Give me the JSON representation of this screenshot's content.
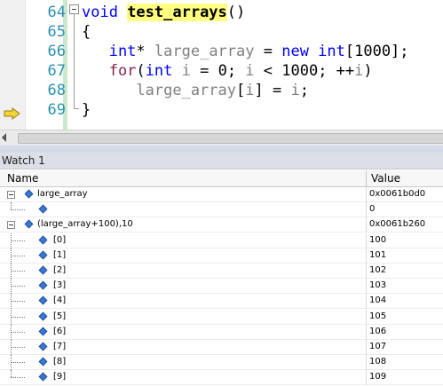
{
  "editor": {
    "lines": [
      {
        "num": "64",
        "parts": [
          {
            "t": "void ",
            "c": "kw"
          },
          {
            "t": "test_arrays",
            "c": "fnhl"
          },
          {
            "t": "()",
            "c": "plain"
          }
        ]
      },
      {
        "num": "65",
        "parts": [
          {
            "t": "{",
            "c": "plain"
          }
        ]
      },
      {
        "num": "66",
        "parts": [
          {
            "t": "   int",
            "c": "kw"
          },
          {
            "t": "* ",
            "c": "plain"
          },
          {
            "t": "large_array",
            "c": "ident"
          },
          {
            "t": " = ",
            "c": "plain"
          },
          {
            "t": "new int",
            "c": "kw"
          },
          {
            "t": "[1000];",
            "c": "plain"
          }
        ]
      },
      {
        "num": "67",
        "parts": [
          {
            "t": "   for",
            "c": "kw2"
          },
          {
            "t": "(",
            "c": "plain"
          },
          {
            "t": "int ",
            "c": "kw"
          },
          {
            "t": "i",
            "c": "ident"
          },
          {
            "t": " = 0; ",
            "c": "plain"
          },
          {
            "t": "i",
            "c": "ident"
          },
          {
            "t": " < 1000; ++",
            "c": "plain"
          },
          {
            "t": "i",
            "c": "ident"
          },
          {
            "t": ")",
            "c": "plain"
          }
        ]
      },
      {
        "num": "68",
        "parts": [
          {
            "t": "      large_array",
            "c": "ident"
          },
          {
            "t": "[",
            "c": "plain"
          },
          {
            "t": "i",
            "c": "ident"
          },
          {
            "t": "] = ",
            "c": "plain"
          },
          {
            "t": "i",
            "c": "ident"
          },
          {
            "t": ";",
            "c": "plain"
          }
        ]
      },
      {
        "num": "69",
        "parts": [
          {
            "t": "}",
            "c": "plain"
          }
        ]
      }
    ],
    "execution_pointer_line": "69"
  },
  "watch": {
    "title": "Watch 1",
    "columns": {
      "name": "Name",
      "value": "Value"
    },
    "rows": [
      {
        "name": "large_array",
        "value": "0x0061b0d0",
        "level": 0,
        "expandable": true
      },
      {
        "name": "",
        "value": "0",
        "level": 1,
        "expandable": false
      },
      {
        "name": "(large_array+100),10",
        "value": "0x0061b260",
        "level": 0,
        "expandable": true
      },
      {
        "name": "[0]",
        "value": "100",
        "level": 1,
        "expandable": false
      },
      {
        "name": "[1]",
        "value": "101",
        "level": 1,
        "expandable": false
      },
      {
        "name": "[2]",
        "value": "102",
        "level": 1,
        "expandable": false
      },
      {
        "name": "[3]",
        "value": "103",
        "level": 1,
        "expandable": false
      },
      {
        "name": "[4]",
        "value": "104",
        "level": 1,
        "expandable": false
      },
      {
        "name": "[5]",
        "value": "105",
        "level": 1,
        "expandable": false
      },
      {
        "name": "[6]",
        "value": "106",
        "level": 1,
        "expandable": false
      },
      {
        "name": "[7]",
        "value": "107",
        "level": 1,
        "expandable": false
      },
      {
        "name": "[8]",
        "value": "108",
        "level": 1,
        "expandable": false
      },
      {
        "name": "[9]",
        "value": "109",
        "level": 1,
        "expandable": false
      }
    ]
  },
  "colors": {
    "keyword": "#0000ff",
    "keyword_for": "#8b2252",
    "line_number": "#2b91af",
    "identifier": "#808080",
    "highlight": "#ffff80",
    "execution_arrow": "#f5d33a",
    "watch_icon": "#3b78d6"
  }
}
